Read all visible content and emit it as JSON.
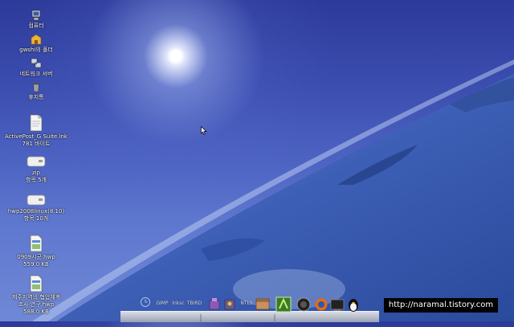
{
  "desktop": {
    "icons": [
      {
        "label": "컴퓨터",
        "icon": "computer-icon"
      },
      {
        "label": "gwshi의 폴더",
        "icon": "home-folder-icon"
      },
      {
        "label": "네트워크 서버",
        "icon": "network-icon"
      },
      {
        "label": "휴지통",
        "icon": "trash-icon"
      },
      {
        "label": "ActivePost_G Suite.lnk",
        "sub": "781 바이트",
        "icon": "document-icon"
      },
      {
        "label": "zip",
        "sub": "항목 5개",
        "icon": "folder-drive-icon"
      },
      {
        "label": "hwp2008linux(8.10)",
        "sub": "항목 10개",
        "icon": "folder-drive-icon"
      },
      {
        "label": "0909시군.hwp",
        "sub": "559.0 KB",
        "icon": "hwp-document-icon"
      },
      {
        "label": "제주지역의 협업체계",
        "label2": "조사 연구.hwp",
        "sub": "588.0 KB",
        "icon": "hwp-document-icon"
      }
    ]
  },
  "dock": {
    "items": [
      "GIMP",
      "Inksc",
      "TBIRD",
      "NTLS"
    ]
  },
  "watermark": "http://naramal.tistory.com"
}
